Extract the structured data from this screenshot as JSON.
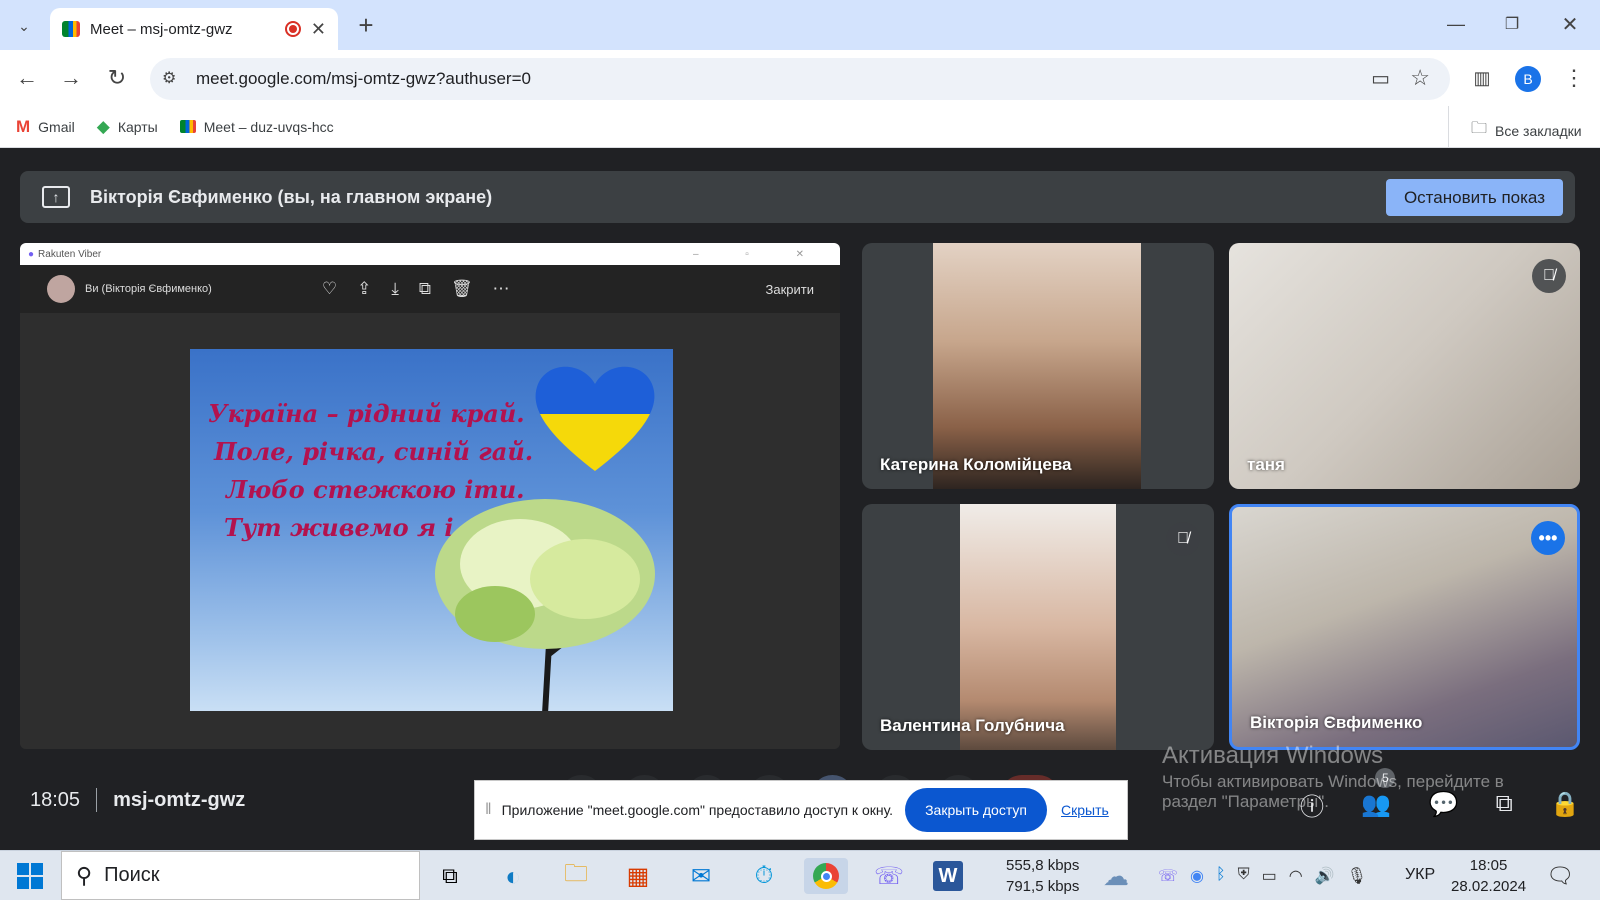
{
  "browser": {
    "tab_title": "Meet – msj-omtz-gwz",
    "url": "meet.google.com/msj-omtz-gwz?authuser=0",
    "profile_initial": "B",
    "bookmarks": [
      "Gmail",
      "Карты",
      "Meet – duz-uvqs-hcc"
    ],
    "all_bookmarks": "Все закладки"
  },
  "meet": {
    "banner_text": "Вікторія Євфименко (вы, на главном экране)",
    "stop_button": "Остановить показ",
    "time": "18:05",
    "meeting_code": "msj-omtz-gwz",
    "participants_count": "5",
    "share_notice": "Приложение \"meet.google.com\" предоставило доступ к окну.",
    "close_access": "Закрыть доступ",
    "hide": "Скрыть"
  },
  "shared_window": {
    "app_title": "Rakuten Viber",
    "user": "Ви (Вікторія Євфименко)",
    "close": "Закрити",
    "poem": [
      "Україна – рідний край.",
      "Поле, річка, синій гай.",
      "Любо стежкою іти.",
      "Тут живемо я і ти."
    ]
  },
  "participants": [
    {
      "name": "Катерина Коломійцева",
      "muted": false
    },
    {
      "name": "таня",
      "muted": true
    },
    {
      "name": "Валентина Голубнича",
      "muted": true
    },
    {
      "name": "Вікторія Євфименко",
      "muted": false
    }
  ],
  "watermark": {
    "title": "Активация Windows",
    "line1": "Чтобы активировать Windows, перейдите в",
    "line2": "раздел \"Параметры\"."
  },
  "taskbar": {
    "search": "Поиск",
    "net_up": "555,8 kbps",
    "net_down": "791,5 kbps",
    "lang": "УКР",
    "clock_time": "18:05",
    "clock_date": "28.02.2024"
  },
  "colors": {
    "accent": "#8ab4f8",
    "meet_bg": "#202124",
    "tile_bg": "#3c4043",
    "tab_strip": "#d3e3fd"
  }
}
